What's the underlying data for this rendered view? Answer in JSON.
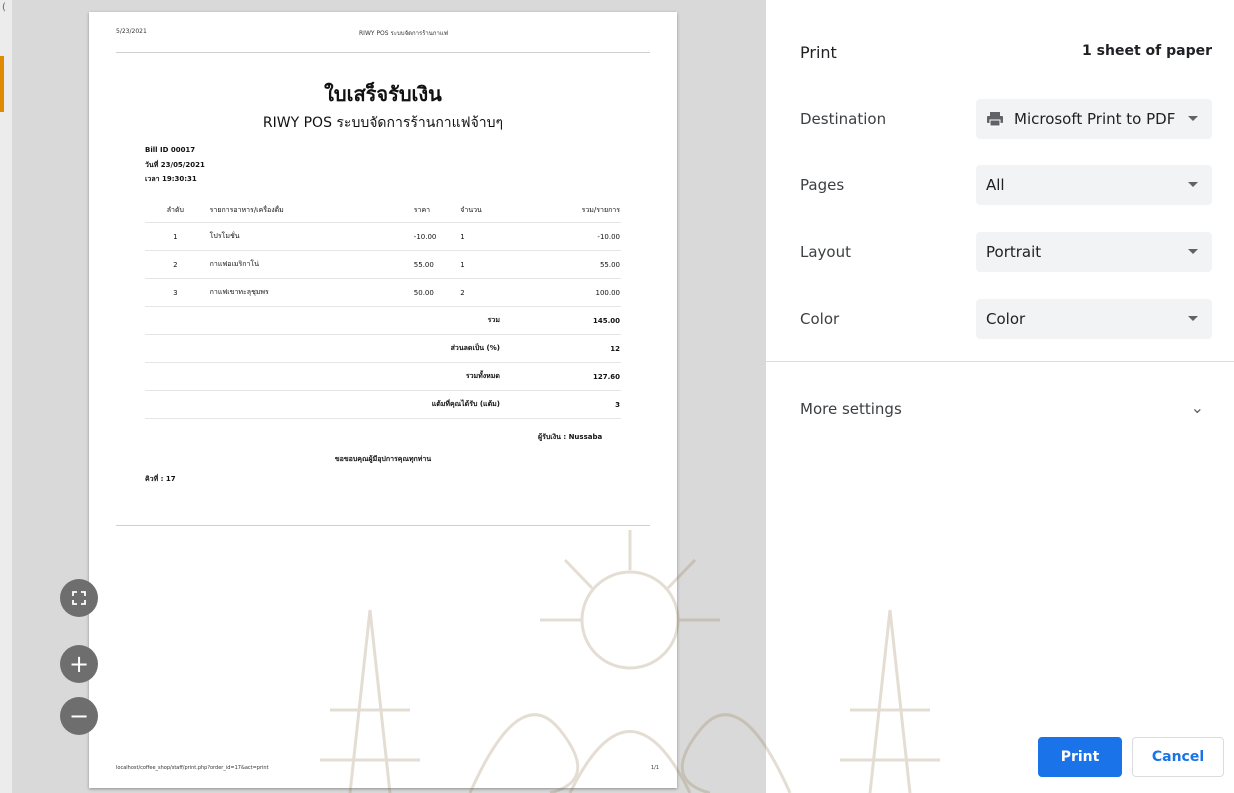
{
  "preview": {
    "left_char": "(",
    "header_date": "5/23/2021",
    "header_title": "RIWY POS ระบบจัดการร้านกาแฟ",
    "footer_url": "localhost/coffee_shop/staff/print.php?order_id=17&act=print",
    "page_number": "1/1",
    "receipt": {
      "title": "ใบเสร็จรับเงิน",
      "subtitle": "RIWY POS ระบบจัดการร้านกาแฟจ้าบๆ",
      "bill_id": "Bill ID 00017",
      "date": "วันที่ 23/05/2021",
      "time": "เวลา 19:30:31",
      "columns": [
        "ลำดับ",
        "รายการอาหาร/เครื่องดื่ม",
        "ราคา",
        "จำนวน",
        "รวม/รายการ"
      ],
      "items": [
        {
          "no": "1",
          "name": "โปรโมชั่น",
          "price": "-10.00",
          "qty": "1",
          "total": "-10.00"
        },
        {
          "no": "2",
          "name": "กาแฟอเมริกาโน่",
          "price": "55.00",
          "qty": "1",
          "total": "55.00"
        },
        {
          "no": "3",
          "name": "กาแฟเขาทะลุชุมพร",
          "price": "50.00",
          "qty": "2",
          "total": "100.00"
        }
      ],
      "summary": [
        {
          "label": "รวม",
          "value": "145.00"
        },
        {
          "label": "ส่วนลดเป็น (%)",
          "value": "12"
        },
        {
          "label": "รวมทั้งหมด",
          "value": "127.60"
        },
        {
          "label": "แต้มที่คุณได้รับ (แต้ม)",
          "value": "3"
        }
      ],
      "cashier": "ผู้รับเงิน : Nussaba",
      "thanks": "ขอขอบคุณผู้มีอุปการคุณทุกท่าน",
      "queue": "คิวที่ : 17"
    }
  },
  "zoom": {
    "fit_icon": "fit-to-page-icon",
    "zoom_in": "+",
    "zoom_out": "−"
  },
  "panel": {
    "title": "Print",
    "sheet_count": "1 sheet of paper",
    "destination_label": "Destination",
    "destination_value": "Microsoft Print to PDF",
    "pages_label": "Pages",
    "pages_value": "All",
    "layout_label": "Layout",
    "layout_value": "Portrait",
    "color_label": "Color",
    "color_value": "Color",
    "more_settings": "More settings",
    "print_button": "Print",
    "cancel_button": "Cancel"
  },
  "colors": {
    "accent": "#1a73e8",
    "select_bg": "#f1f3f4",
    "preview_bg": "#d9d9d9"
  }
}
